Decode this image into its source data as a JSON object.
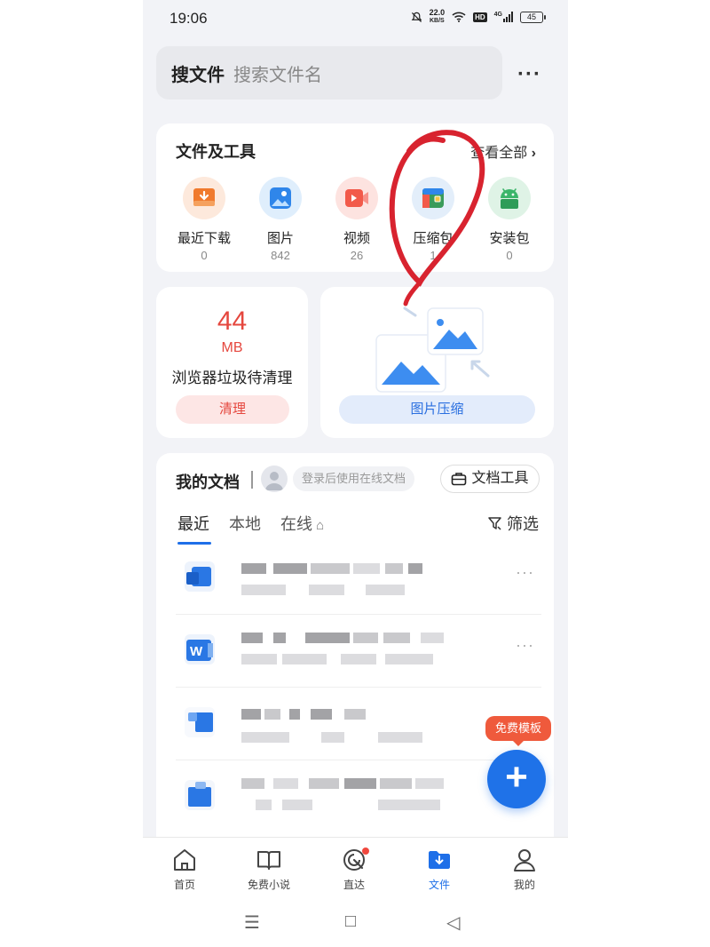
{
  "status_bar": {
    "time": "19:06",
    "net_speed_value": "22.0",
    "net_speed_unit": "KB/S",
    "hd": "HD",
    "signal": "4G",
    "battery": "45"
  },
  "search": {
    "label": "搜文件",
    "placeholder": "搜索文件名"
  },
  "tools_card": {
    "title": "文件及工具",
    "view_all": "查看全部",
    "items": [
      {
        "name": "最近下载",
        "count": "0",
        "icon": "download-icon",
        "color": "#f07a2d"
      },
      {
        "name": "图片",
        "count": "842",
        "icon": "image-icon",
        "color": "#2f86ea"
      },
      {
        "name": "视频",
        "count": "26",
        "icon": "video-icon",
        "color": "#f25a4a"
      },
      {
        "name": "压缩包",
        "count": "1",
        "icon": "archive-icon",
        "color": "#3a9b5a"
      },
      {
        "name": "安装包",
        "count": "0",
        "icon": "android-icon",
        "color": "#3bb56a"
      }
    ]
  },
  "clean_card": {
    "value": "44",
    "unit": "MB",
    "description": "浏览器垃圾待清理",
    "button": "清理"
  },
  "compress_card": {
    "button": "图片压缩"
  },
  "docs_card": {
    "title": "我的文档",
    "login_hint": "登录后使用在线文档",
    "tools_button": "文档工具",
    "tabs": [
      "最近",
      "本地",
      "在线"
    ],
    "filter": "筛选"
  },
  "fab": {
    "badge": "免费模板",
    "label": "+"
  },
  "bottom_nav": [
    {
      "label": "首页",
      "icon": "home-icon"
    },
    {
      "label": "免费小说",
      "icon": "book-icon"
    },
    {
      "label": "直达",
      "icon": "direct-icon"
    },
    {
      "label": "文件",
      "icon": "folder-icon",
      "active": true
    },
    {
      "label": "我的",
      "icon": "profile-icon"
    }
  ],
  "system_nav": {
    "menu": "☰",
    "home": "□",
    "back": "◁"
  },
  "colors": {
    "accent": "#1e6fe8",
    "danger": "#e5473e",
    "annotation": "#d8232f"
  }
}
